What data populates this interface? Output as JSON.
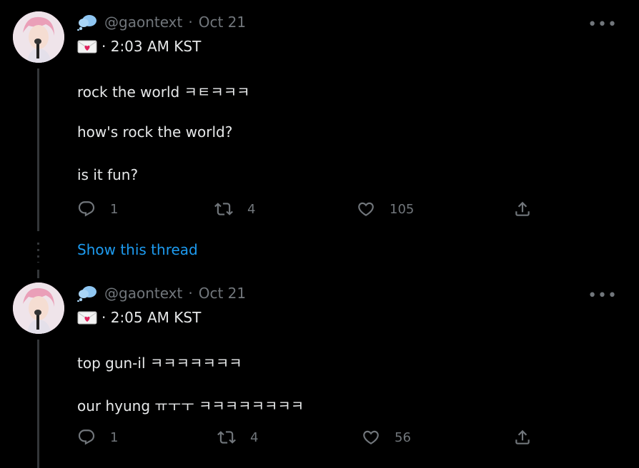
{
  "tweets": [
    {
      "handle": "@gaontext",
      "sep": "·",
      "date": "Oct 21",
      "time_line": "· 2:03 AM KST",
      "lines": [
        "rock the world ㅋㅌㅋㅋㅋ",
        "how's rock the world?",
        "is it fun?"
      ],
      "replies": "1",
      "retweets": "4",
      "likes": "105"
    },
    {
      "handle": "@gaontext",
      "sep": "·",
      "date": "Oct 21",
      "time_line": "· 2:05 AM KST",
      "lines": [
        "top gun-il ㅋㅋㅋㅋㅋㅋㅋ",
        "our hyung ㅠㅜㅜ ㅋㅋㅋㅋㅋㅋㅋㅋ"
      ],
      "replies": "1",
      "retweets": "4",
      "likes": "56"
    }
  ],
  "show_thread": "Show this thread",
  "more_label": "•••",
  "icons": {
    "cloud": "cloud-icon",
    "envelope": "love-letter-icon",
    "reply": "reply-icon",
    "retweet": "retweet-icon",
    "like": "heart-icon",
    "share": "share-icon",
    "more": "more-icon"
  },
  "colors": {
    "background": "#000000",
    "text": "#e7e9ea",
    "muted": "#71767b",
    "link": "#1d9bf0",
    "thread_line": "#333639"
  }
}
